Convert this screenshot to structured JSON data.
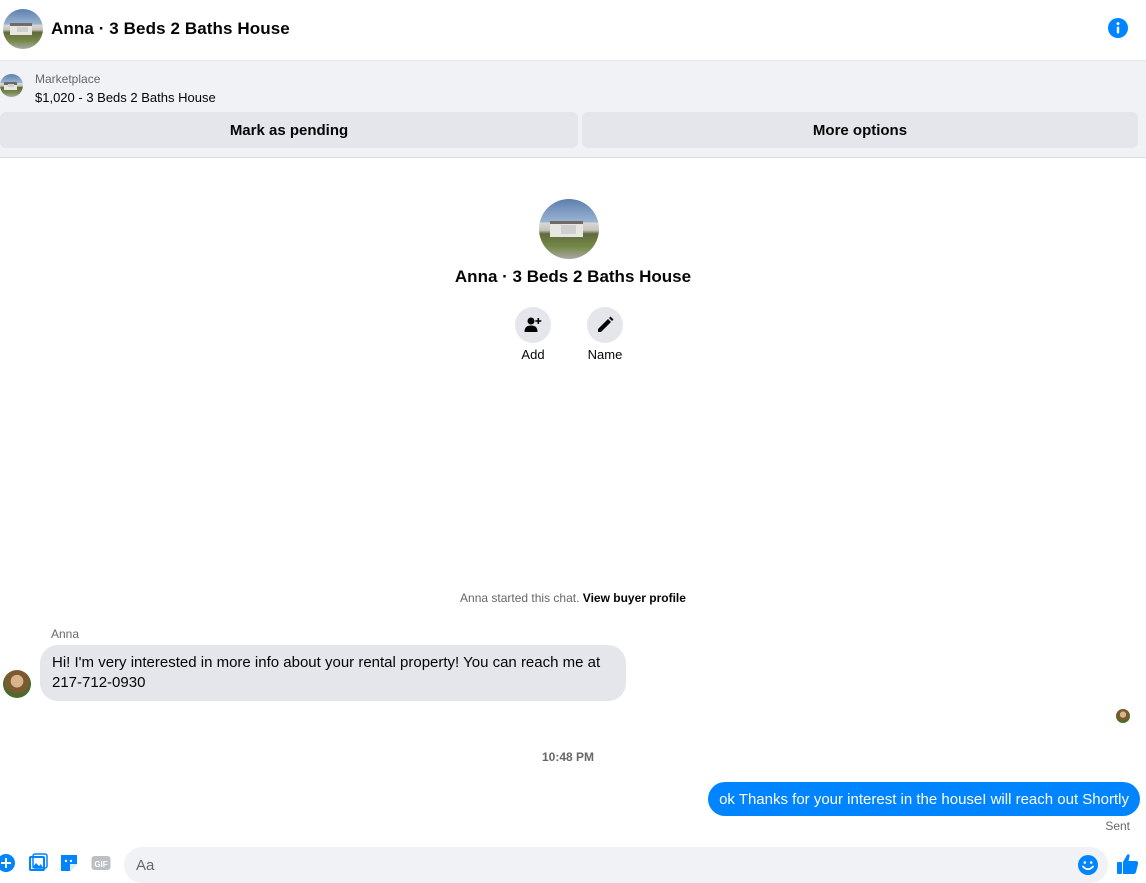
{
  "header": {
    "title": "Anna · 3 Beds 2 Baths House",
    "info_icon": "info-icon"
  },
  "marketplace": {
    "label": "Marketplace",
    "listing": "$1,020 - 3 Beds 2 Baths House",
    "mark_pending": "Mark as pending",
    "more_options": "More options"
  },
  "profile": {
    "name": "Anna · 3 Beds 2 Baths House",
    "add_label": "Add",
    "name_label": "Name"
  },
  "chat": {
    "started_text": "Anna started this chat.",
    "buyer_profile_link": "View buyer profile",
    "sender_name": "Anna",
    "incoming_message": "Hi! I'm very interested in more info about your rental property! You can reach me at 217-712-0930",
    "timestamp": "10:48 PM",
    "outgoing_message": "ok Thanks for your interest in the houseI will reach out Shortly",
    "status": "Sent"
  },
  "composer": {
    "placeholder": "Aa",
    "icons": [
      "plus-icon",
      "photo-icon",
      "sticker-icon",
      "gif-icon",
      "emoji-icon",
      "like-icon"
    ]
  },
  "colors": {
    "accent": "#0084ff",
    "bubble_in": "#e4e6eb",
    "banner_bg": "#f0f2f5"
  }
}
